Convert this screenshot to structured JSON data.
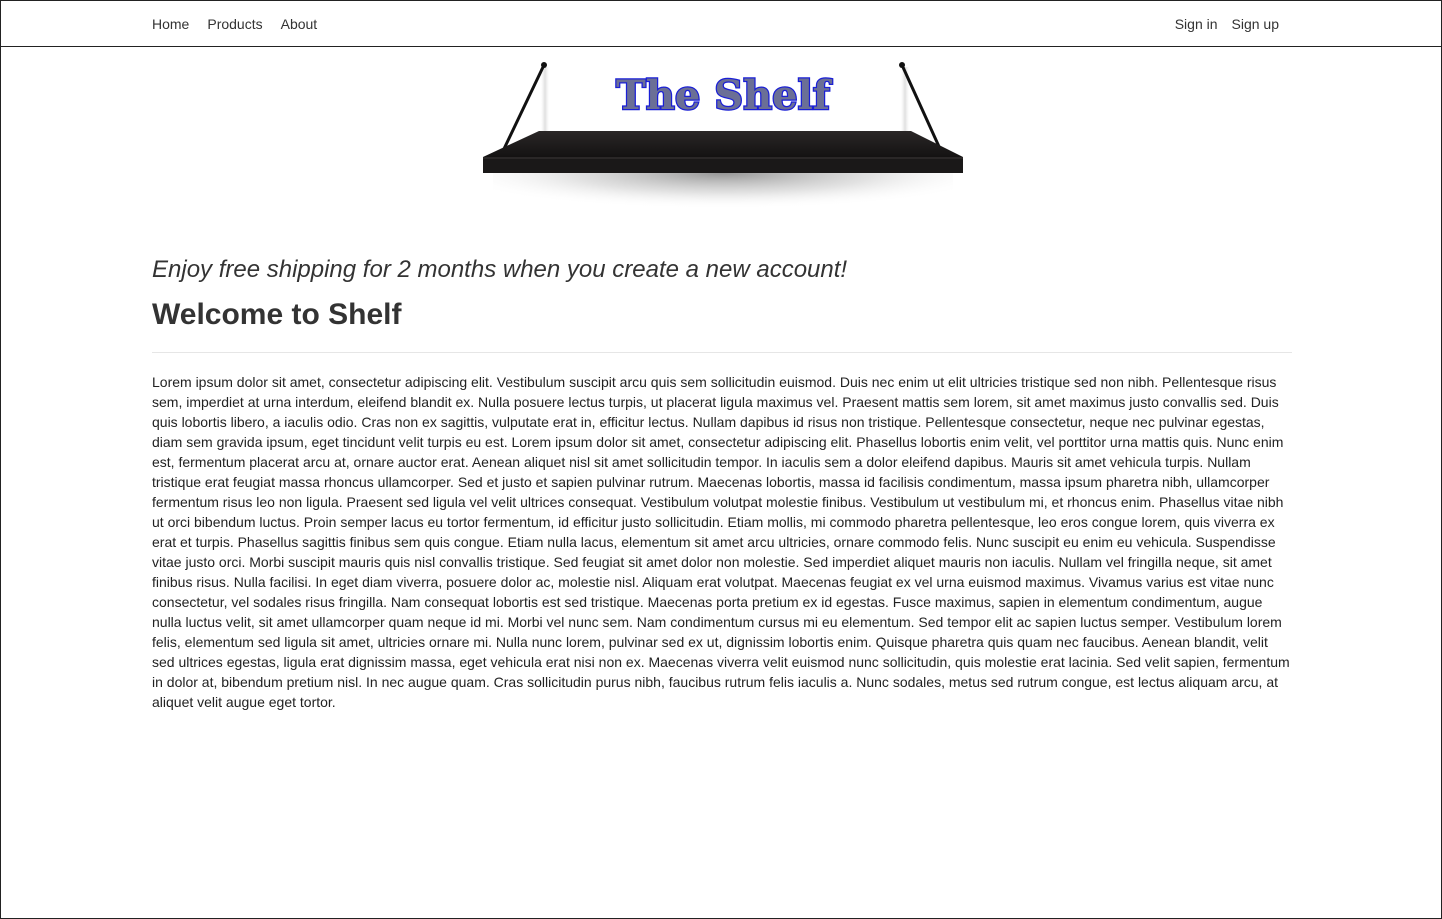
{
  "nav": {
    "home": "Home",
    "products": "Products",
    "about": "About",
    "sign_in": "Sign in",
    "sign_up": "Sign up"
  },
  "logo": {
    "text": "The Shelf",
    "text_fill": "#6b6f96",
    "text_stroke": "#1a1fd6",
    "shelf_color": "#1a1818"
  },
  "main": {
    "promo": "Enjoy free shipping for 2 months when you create a new account!",
    "title": "Welcome to Shelf",
    "body": "Lorem ipsum dolor sit amet, consectetur adipiscing elit. Vestibulum suscipit arcu quis sem sollicitudin euismod. Duis nec enim ut elit ultricies tristique sed non nibh. Pellentesque risus sem, imperdiet at urna interdum, eleifend blandit ex. Nulla posuere lectus turpis, ut placerat ligula maximus vel. Praesent mattis sem lorem, sit amet maximus justo convallis sed. Duis quis lobortis libero, a iaculis odio. Cras non ex sagittis, vulputate erat in, efficitur lectus. Nullam dapibus id risus non tristique. Pellentesque consectetur, neque nec pulvinar egestas, diam sem gravida ipsum, eget tincidunt velit turpis eu est. Lorem ipsum dolor sit amet, consectetur adipiscing elit. Phasellus lobortis enim velit, vel porttitor urna mattis quis. Nunc enim est, fermentum placerat arcu at, ornare auctor erat. Aenean aliquet nisl sit amet sollicitudin tempor. In iaculis sem a dolor eleifend dapibus. Mauris sit amet vehicula turpis. Nullam tristique erat feugiat massa rhoncus ullamcorper. Sed et justo et sapien pulvinar rutrum. Maecenas lobortis, massa id facilisis condimentum, massa ipsum pharetra nibh, ullamcorper fermentum risus leo non ligula. Praesent sed ligula vel velit ultrices consequat. Vestibulum volutpat molestie finibus. Vestibulum ut vestibulum mi, et rhoncus enim. Phasellus vitae nibh ut orci bibendum luctus. Proin semper lacus eu tortor fermentum, id efficitur justo sollicitudin. Etiam mollis, mi commodo pharetra pellentesque, leo eros congue lorem, quis viverra ex erat et turpis. Phasellus sagittis finibus sem quis congue. Etiam nulla lacus, elementum sit amet arcu ultricies, ornare commodo felis. Nunc suscipit eu enim eu vehicula. Suspendisse vitae justo orci. Morbi suscipit mauris quis nisl convallis tristique. Sed feugiat sit amet dolor non molestie. Sed imperdiet aliquet mauris non iaculis. Nullam vel fringilla neque, sit amet finibus risus. Nulla facilisi. In eget diam viverra, posuere dolor ac, molestie nisl. Aliquam erat volutpat. Maecenas feugiat ex vel urna euismod maximus. Vivamus varius est vitae nunc consectetur, vel sodales risus fringilla. Nam consequat lobortis est sed tristique. Maecenas porta pretium ex id egestas. Fusce maximus, sapien in elementum condimentum, augue nulla luctus velit, sit amet ullamcorper quam neque id mi. Morbi vel nunc sem. Nam condimentum cursus mi eu elementum. Sed tempor elit ac sapien luctus semper. Vestibulum lorem felis, elementum sed ligula sit amet, ultricies ornare mi. Nulla nunc lorem, pulvinar sed ex ut, dignissim lobortis enim. Quisque pharetra quis quam nec faucibus. Aenean blandit, velit sed ultrices egestas, ligula erat dignissim massa, eget vehicula erat nisi non ex. Maecenas viverra velit euismod nunc sollicitudin, quis molestie erat lacinia. Sed velit sapien, fermentum in dolor at, bibendum pretium nisl. In nec augue quam. Cras sollicitudin purus nibh, faucibus rutrum felis iaculis a. Nunc sodales, metus sed rutrum congue, est lectus aliquam arcu, at aliquet velit augue eget tortor."
  }
}
